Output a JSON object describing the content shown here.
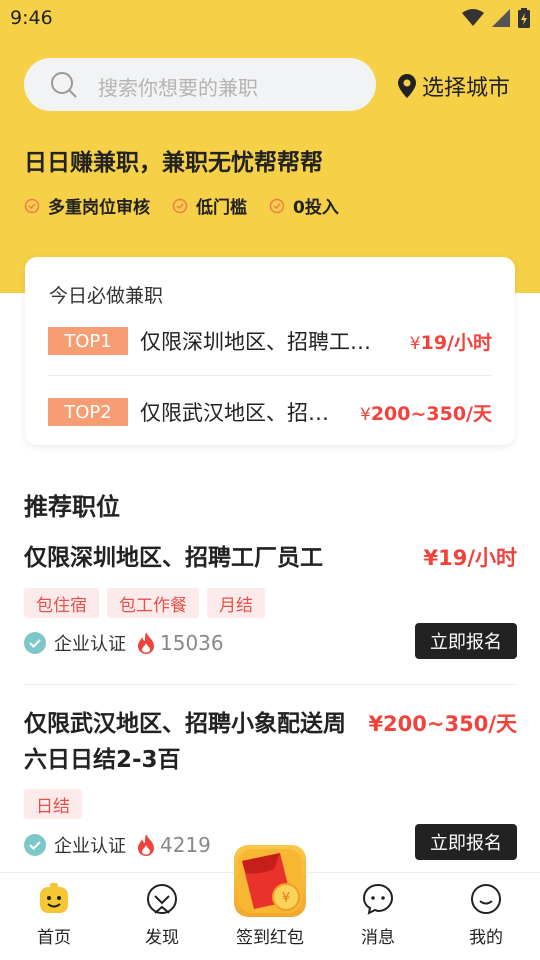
{
  "status": {
    "time": "9:46"
  },
  "search": {
    "placeholder": "搜索你想要的兼职"
  },
  "city": {
    "label": "选择城市"
  },
  "banner": {
    "slogan": "日日赚兼职，兼职无忧帮帮帮",
    "features": [
      "多重岗位审核",
      "低门槛",
      "0投入"
    ]
  },
  "today": {
    "title": "今日必做兼职",
    "items": [
      {
        "rank": "TOP1",
        "title": "仅限深圳地区、招聘工…",
        "yen": "¥",
        "price": "19/小时"
      },
      {
        "rank": "TOP2",
        "title": "仅限武汉地区、招…",
        "yen": "¥",
        "price": "200~350/天"
      }
    ]
  },
  "recommend": {
    "title": "推荐职位",
    "jobs": [
      {
        "title": "仅限深圳地区、招聘工厂员工",
        "price": "¥19/小时",
        "tags": [
          "包住宿",
          "包工作餐",
          "月结"
        ],
        "cert": "企业认证",
        "hot": "15036",
        "apply": "立即报名"
      },
      {
        "title_line1": "仅限武汉地区、招聘小象配送周",
        "title_line2": "六日日结2-3百",
        "price": "¥200~350/天",
        "tags": [
          "日结"
        ],
        "cert": "企业认证",
        "hot": "4219",
        "apply": "立即报名"
      }
    ]
  },
  "tabbar": {
    "items": [
      {
        "label": "首页",
        "icon": "home-face-icon"
      },
      {
        "label": "发现",
        "icon": "discover-icon"
      },
      {
        "label": "签到红包",
        "icon": "red-envelope-icon"
      },
      {
        "label": "消息",
        "icon": "message-icon"
      },
      {
        "label": "我的",
        "icon": "profile-face-icon"
      }
    ]
  },
  "colors": {
    "brand_yellow": "#f6d046",
    "price_red": "#f1433c",
    "top_badge": "#f79d73",
    "tag_bg": "#fdebeb",
    "tag_text": "#e8514a",
    "cert_teal": "#7ec7c8"
  }
}
